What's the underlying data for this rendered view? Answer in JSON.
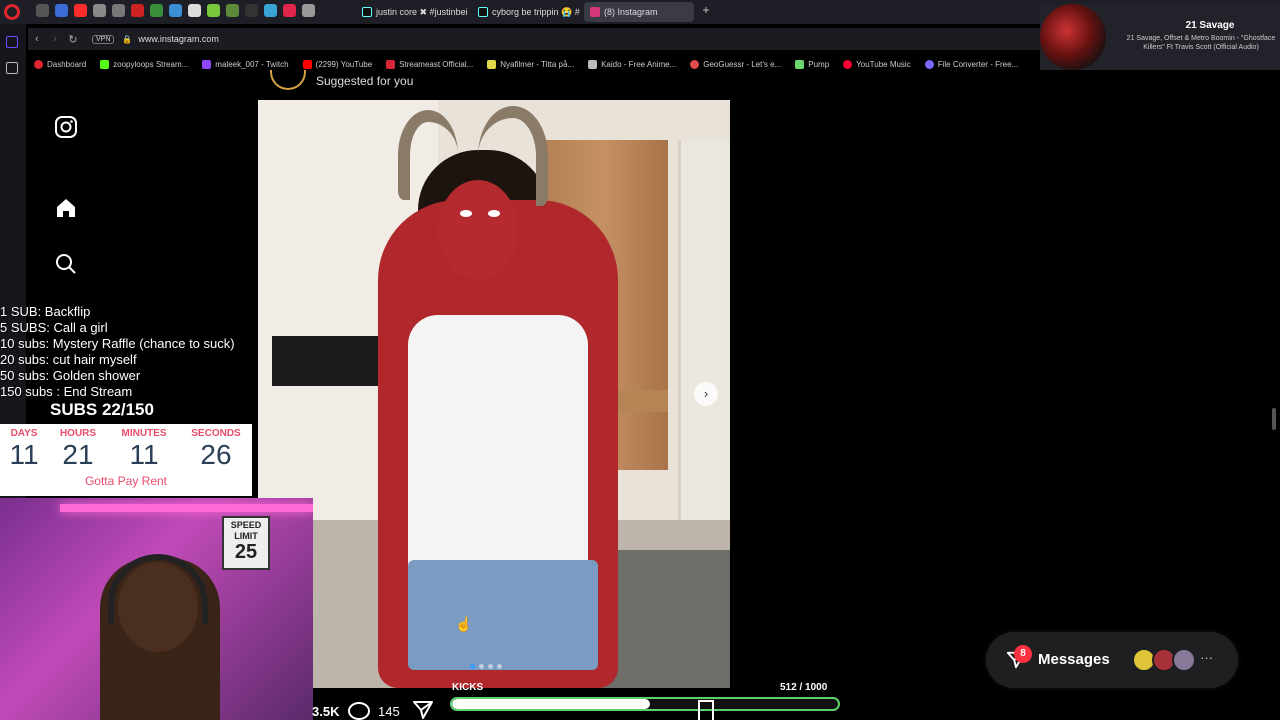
{
  "browser": {
    "tabs": [
      {
        "label": "justin core ✖ #justinbeib"
      },
      {
        "label": "cyborg be trippin 😭 #m"
      },
      {
        "label": "(8) Instagram"
      }
    ],
    "url": "www.instagram.com",
    "vpn_label": "VPN",
    "bookmarks": [
      "Dashboard",
      "zoopyloops Stream...",
      "maleek_007 - Twitch",
      "(2299) YouTube",
      "Streameast Official...",
      "Nyafilmer - Titta på...",
      "Kaido - Free Anime...",
      "GeoGuessr - Let's e...",
      "Pump",
      "YouTube Music",
      "File Converter - Free..."
    ]
  },
  "now_playing": {
    "artist": "21 Savage",
    "title": "21 Savage, Offset & Metro Boomin - \"Ghostface Killers\" Ft Travis Scott (Official Audio)"
  },
  "instagram": {
    "suggested_label": "Suggested for you",
    "likes": "3.5K",
    "comments": "145",
    "carousel": {
      "count": 4,
      "active_index": 0
    },
    "messages": {
      "label": "Messages",
      "badge": "8",
      "more": "···"
    }
  },
  "stream_overlay": {
    "goals": [
      "1 SUB: Backflip",
      "5 SUBS: Call a girl",
      "10 subs: Mystery Raffle (chance to suck)",
      "20 subs: cut hair myself",
      "50 subs: Golden shower",
      "150 subs : End Stream"
    ],
    "subs_progress": "SUBS 22/150",
    "timer": {
      "labels": [
        "DAYS",
        "HOURS",
        "MINUTES",
        "SECONDS"
      ],
      "values": [
        "11",
        "21",
        "11",
        "26"
      ],
      "footer": "Gotta Pay Rent"
    },
    "webcam_sign": {
      "line1": "SPEED",
      "line2": "LIMIT",
      "line3": "25"
    },
    "kicks": {
      "label": "KICKS",
      "count": "512  / 1000",
      "fraction": 0.512
    }
  },
  "colors": {
    "kicks_border": "#5bd16c",
    "timer_label": "#e94c6c",
    "timer_value": "#2b4057",
    "badge": "#ff3040",
    "carousel_active": "#3a9bff"
  }
}
